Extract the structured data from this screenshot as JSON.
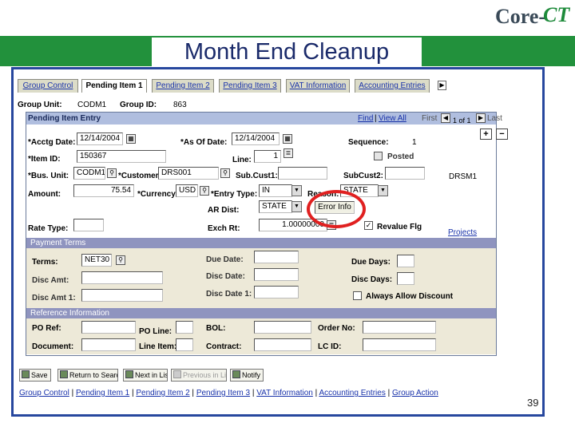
{
  "logo": {
    "part1": "Core-",
    "part2": "CT"
  },
  "banner": {
    "title": "Month End Cleanup"
  },
  "tabs": [
    {
      "label": "Group Control"
    },
    {
      "label": "Pending Item 1"
    },
    {
      "label": "Pending Item 2"
    },
    {
      "label": "Pending Item 3"
    },
    {
      "label": "VAT Information"
    },
    {
      "label": "Accounting Entries"
    }
  ],
  "header": {
    "group_unit_label": "Group Unit:",
    "group_unit_value": "CODM1",
    "group_id_label": "Group ID:",
    "group_id_value": "863"
  },
  "panel": {
    "title": "Pending Item Entry",
    "find": "Find",
    "view_all": "View All",
    "first": "First",
    "counter": "1 of 1",
    "last": "Last",
    "plus": "+",
    "minus": "−"
  },
  "fields": {
    "acctg_date_label": "*Acctg Date:",
    "acctg_date": "12/14/2004",
    "as_of_date_label": "*As Of Date:",
    "as_of_date": "12/14/2004",
    "sequence_label": "Sequence:",
    "sequence": "1",
    "item_id_label": "*Item ID:",
    "item_id": "150367",
    "line_label": "Line:",
    "line": "1",
    "posted_label": "Posted",
    "bus_unit_label": "*Bus. Unit:",
    "bus_unit": "CODM1",
    "customer_label": "*Customer:",
    "customer": "DRS001",
    "subcust1_label": "Sub.Cust1:",
    "subcust2_label": "SubCust2:",
    "subcust2_side": "DRSM1",
    "amount_label": "Amount:",
    "amount": "75.54",
    "currency_label": "*Currency:",
    "currency": "USD",
    "entry_type_label": "*Entry Type:",
    "entry_type": "IN",
    "reason_label": "Reason:",
    "reason": "STATE",
    "ar_dist_label": "AR Dist:",
    "ar_dist": "STATE",
    "error_info": "Error Info",
    "rate_type_label": "Rate Type:",
    "exch_rt_label": "Exch Rt:",
    "exch_rt": "1.00000000",
    "revalue_label": "Revalue Flg",
    "projects": "Projects"
  },
  "payment": {
    "title": "Payment Terms",
    "terms_label": "Terms:",
    "terms": "NET30",
    "due_date_label": "Due Date:",
    "due_days_label": "Due Days:",
    "disc_amt_label": "Disc Amt:",
    "disc_date_label": "Disc Date:",
    "disc_days_label": "Disc Days:",
    "disc_amt1_label": "Disc Amt 1:",
    "disc_date1_label": "Disc Date 1:",
    "always_allow_label": "Always Allow Discount"
  },
  "reference": {
    "title": "Reference Information",
    "po_ref_label": "PO Ref:",
    "po_line_label": "PO Line:",
    "bol_label": "BOL:",
    "order_no_label": "Order No:",
    "document_label": "Document:",
    "line_item_label": "Line Item:",
    "contract_label": "Contract:",
    "lc_id_label": "LC ID:"
  },
  "buttons": {
    "save": "Save",
    "return": "Return to Search",
    "next": "Next in List",
    "previous": "Previous in List",
    "notify": "Notify"
  },
  "bottom_links": [
    "Group Control",
    "Pending Item 1",
    "Pending Item 2",
    "Pending Item 3",
    "VAT Information",
    "Accounting Entries",
    "Group Action"
  ],
  "page_number": "39"
}
